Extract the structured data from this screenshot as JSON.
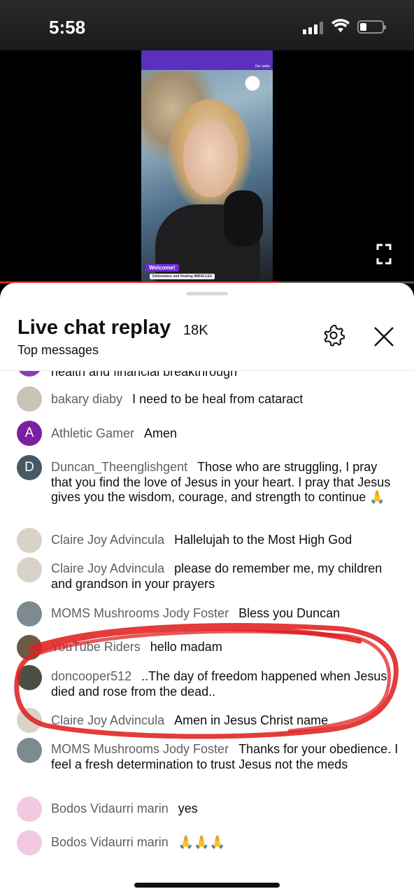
{
  "status_bar": {
    "time": "5:58",
    "battery_level": 0.3
  },
  "video": {
    "channel_text": "Our webs",
    "welcome_badge": "Welcome!",
    "lower_third": "Deliverance and Healing MIRACLES",
    "progress": 0.675
  },
  "chat": {
    "title": "Live chat replay",
    "count": "18K",
    "mode": "Top messages",
    "previous_partial": "health and financial breakthrough",
    "messages": [
      {
        "author": "bakary diaby",
        "text": "I need to be heal from cataract",
        "avatar": "photo",
        "avatar_color": "#c9c3b8"
      },
      {
        "author": "Athletic Gamer",
        "text": "Amen",
        "avatar": "A",
        "avatar_color": "#7b1fa2"
      },
      {
        "author": "Duncan_Theenglishgent",
        "text": "Those who are struggling, I pray that you find the love of Jesus in your heart. I pray that Jesus gives you the wisdom, courage, and strength to continue 🙏",
        "avatar": "D",
        "avatar_color": "#455a64"
      },
      {
        "author": "Claire Joy Advincula",
        "text": "Hallelujah to the Most High God",
        "avatar": "photo",
        "avatar_color": "#d9d2c9"
      },
      {
        "author": "Claire Joy Advincula",
        "text": "please do remember me, my children and grandson in your prayers",
        "avatar": "photo",
        "avatar_color": "#d9d2c9"
      },
      {
        "author": "MOMS Mushrooms Jody Foster",
        "text": "Bless you Duncan",
        "avatar": "photo",
        "avatar_color": "#7d8a8f"
      },
      {
        "author": "YouTube Riders",
        "text": "hello madam",
        "avatar": "photo",
        "avatar_color": "#6b5a44"
      },
      {
        "author": "doncooper512",
        "text": "..The day of freedom happened when Jesus died and rose from the dead..",
        "avatar": "photo",
        "avatar_color": "#4a4f45"
      },
      {
        "author": "Claire Joy Advincula",
        "text": "Amen in Jesus Christ name",
        "avatar": "photo",
        "avatar_color": "#d9d2c9"
      },
      {
        "author": "MOMS Mushrooms Jody Foster",
        "text": "Thanks for your obedience. I feel a fresh determination to trust Jesus not the meds",
        "avatar": "photo",
        "avatar_color": "#7d8a8f"
      },
      {
        "author": "Bodos Vidaurri marin",
        "text": "yes",
        "avatar": "photo",
        "avatar_color": "#f2c9e0"
      },
      {
        "author": "Bodos Vidaurri marin",
        "text": "🙏🙏🙏",
        "avatar": "photo",
        "avatar_color": "#f2c9e0"
      }
    ]
  },
  "icons": {
    "settings": "gear-icon",
    "close": "close-icon",
    "fullscreen": "fullscreen-icon"
  },
  "colors": {
    "video_topbar": "#5b2fc0",
    "progress": "#e52222",
    "annotation": "#e02020"
  }
}
